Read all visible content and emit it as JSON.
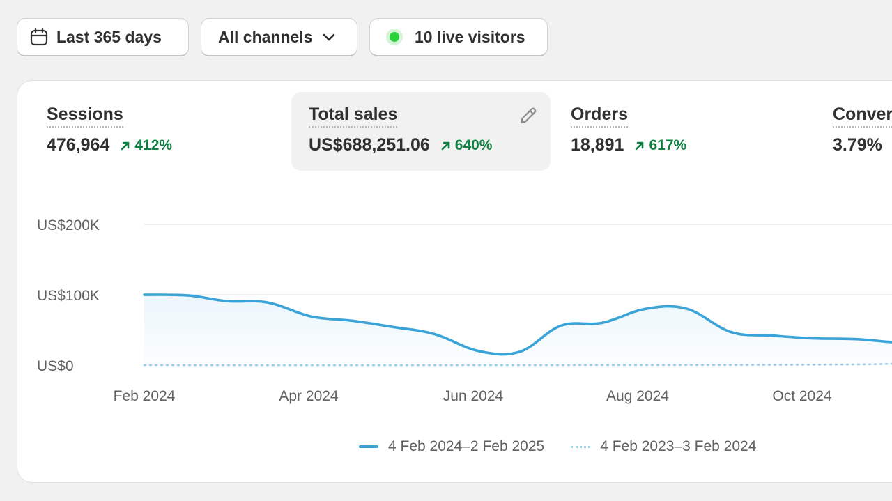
{
  "filters": {
    "date_range": {
      "label": "Last 365 days",
      "icon": "calendar-icon"
    },
    "channels": {
      "label": "All channels",
      "icon": "chevron-down-icon"
    },
    "live_visitors": {
      "label": "10 live visitors",
      "status_color": "#29d23b"
    }
  },
  "metrics": [
    {
      "label": "Sessions",
      "value": "476,964",
      "change": "412%",
      "trend": "up"
    },
    {
      "label": "Total sales",
      "value": "US$688,251.06",
      "change": "640%",
      "trend": "up",
      "active": true,
      "icon": "pencil-icon"
    },
    {
      "label": "Orders",
      "value": "18,891",
      "change": "617%",
      "trend": "up"
    },
    {
      "label": "Conver",
      "value": "3.79%",
      "change": "",
      "trend": ""
    }
  ],
  "colors": {
    "accent": "#3aa3d8",
    "positive": "#108043",
    "comparison": "#9ccfe8"
  },
  "chart_data": {
    "type": "line",
    "x_ticks": [
      "Feb 2024",
      "Apr 2024",
      "Jun 2024",
      "Aug 2024",
      "Oct 2024"
    ],
    "y_ticks": [
      "US$200K",
      "US$100K",
      "US$0"
    ],
    "ylim": [
      0,
      200000
    ],
    "grid": true,
    "legend_position": "bottom",
    "series": [
      {
        "name": "4 Feb 2024–2 Feb 2025",
        "style": "solid",
        "color": "#3aa3d8",
        "x": [
          "2024-02-04",
          "2024-02-20",
          "2024-03-05",
          "2024-03-20",
          "2024-04-05",
          "2024-04-20",
          "2024-05-05",
          "2024-05-20",
          "2024-06-05",
          "2024-06-20",
          "2024-07-05",
          "2024-07-20",
          "2024-08-05",
          "2024-08-20",
          "2024-09-05",
          "2024-09-20",
          "2024-10-05",
          "2024-10-20",
          "2024-11-05",
          "2024-11-20"
        ],
        "y": [
          100000,
          99000,
          91000,
          89000,
          69000,
          63000,
          54000,
          44000,
          20000,
          19000,
          56000,
          60000,
          80000,
          80000,
          47000,
          42000,
          38000,
          37000,
          32000,
          29000
        ]
      },
      {
        "name": "4 Feb 2023–3 Feb 2024",
        "style": "dotted",
        "color": "#9ccfe8",
        "x": [
          "2024-02-04",
          "2024-06-01",
          "2024-10-20",
          "2024-11-05",
          "2024-11-20"
        ],
        "y": [
          0,
          0,
          1000,
          5000,
          6000
        ]
      }
    ]
  }
}
